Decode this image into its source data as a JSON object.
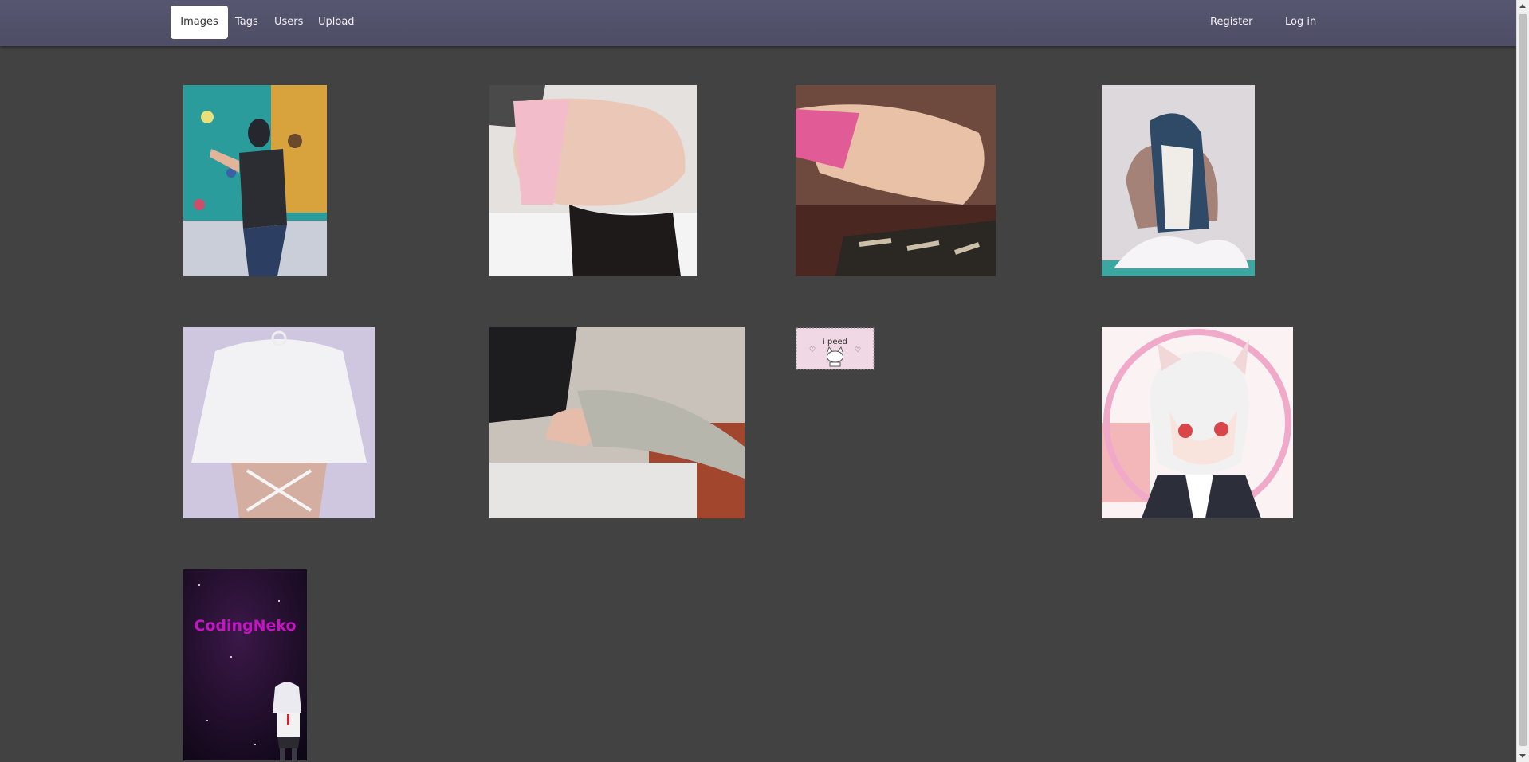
{
  "nav": {
    "left": [
      "Images",
      "Tags",
      "Users",
      "Upload"
    ],
    "right": [
      "Register",
      "Log in"
    ],
    "active": "Images"
  },
  "gallery": {
    "tiles": [
      {
        "name": "climbing-wall-photo"
      },
      {
        "name": "pink-underwear-photo"
      },
      {
        "name": "pink-shorts-photo"
      },
      {
        "name": "shark-plush-photo"
      },
      {
        "name": "white-crop-top-photo"
      },
      {
        "name": "grey-cargo-pants-photo"
      },
      {
        "name": "i-peed-sticker",
        "text": "i peed",
        "hearts": [
          "♡",
          "♡"
        ]
      },
      {
        "name": "anime-catboy-avatar"
      },
      {
        "name": "codingneko-poster",
        "text": "CodingNeko"
      }
    ]
  },
  "colors": {
    "background": "#424242",
    "navbar": "#55546b",
    "codingneko_text": "#c414c4"
  }
}
